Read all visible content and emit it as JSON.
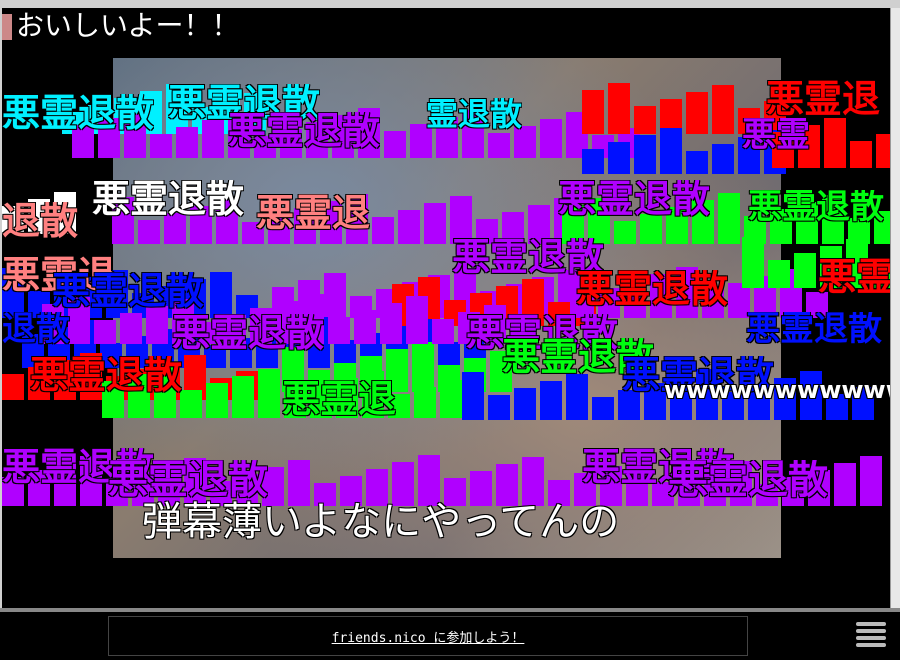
{
  "player": {
    "top_comment": "おいしいよー！！",
    "bottom_caption": "弾幕薄いよなにやってんの",
    "laugh_comment": "wwwwwwwwwww面白",
    "danmaku_text": "悪霊退散",
    "danmaku_fragments": {
      "a": "悪霊退散",
      "b": "霊退散",
      "c": "退散",
      "d": "悪霊退",
      "e": "悪霊",
      "f": "散"
    }
  },
  "footer": {
    "banner_text": "friends.nico に参加しよう！",
    "menu_icon": "menu-icon"
  },
  "colors": {
    "cyan": "#00f0ff",
    "purple": "#b000ff",
    "red": "#ff0000",
    "blue": "#0010ff",
    "green": "#00ff10",
    "white": "#ffffff",
    "pink": "#ff8080"
  }
}
